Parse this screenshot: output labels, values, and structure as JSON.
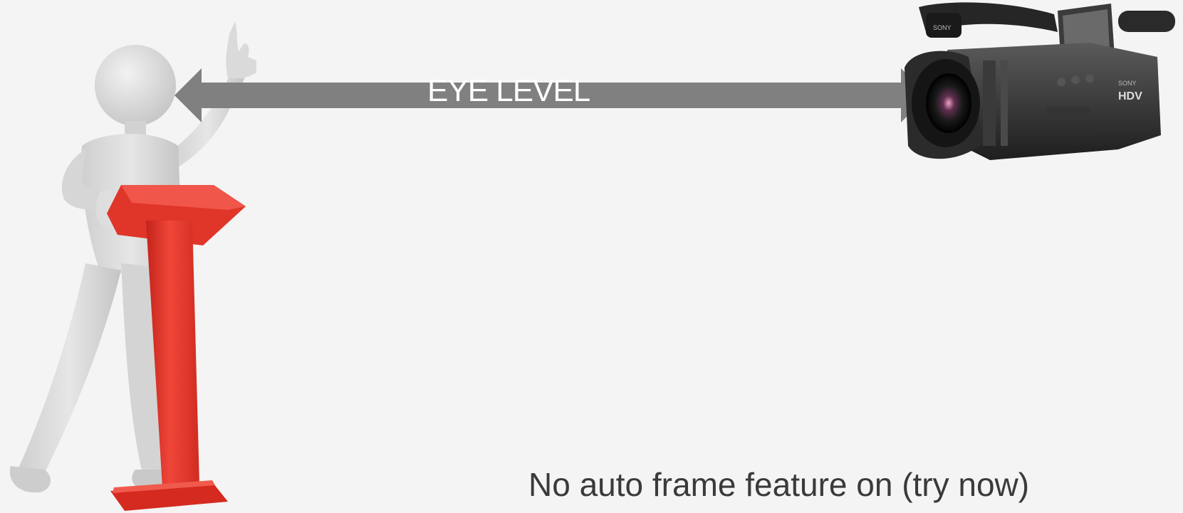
{
  "arrow": {
    "label": "EYE LEVEL",
    "color": "#808080",
    "label_color": "#ffffff"
  },
  "caption": {
    "text": "No auto frame feature on (try now)"
  },
  "figure": {
    "icon": "presenter-at-podium-icon",
    "body_color": "#dcdcdc",
    "podium_color": "#e8352a"
  },
  "camera": {
    "icon": "video-camera-icon",
    "brand": "SONY",
    "badge": "HDV"
  }
}
